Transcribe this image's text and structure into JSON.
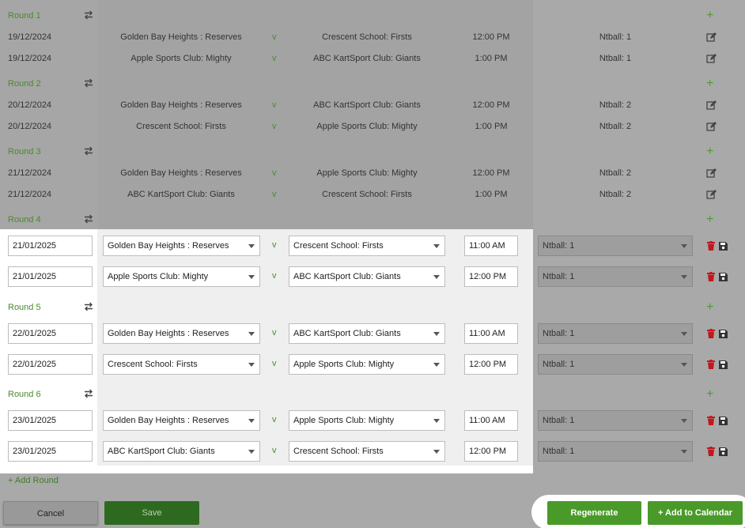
{
  "rounds_readonly": [
    {
      "label": "Round 1",
      "fixtures": [
        {
          "date": "19/12/2024",
          "home": "Golden Bay Heights : Reserves",
          "vs": "v",
          "away": "Crescent School: Firsts",
          "time": "12:00 PM",
          "venue": "Ntball: 1"
        },
        {
          "date": "19/12/2024",
          "home": "Apple Sports Club: Mighty",
          "vs": "v",
          "away": "ABC KartSport Club: Giants",
          "time": "1:00 PM",
          "venue": "Ntball: 1"
        }
      ]
    },
    {
      "label": "Round 2",
      "fixtures": [
        {
          "date": "20/12/2024",
          "home": "Golden Bay Heights : Reserves",
          "vs": "v",
          "away": "ABC KartSport Club: Giants",
          "time": "12:00 PM",
          "venue": "Ntball: 2"
        },
        {
          "date": "20/12/2024",
          "home": "Crescent School: Firsts",
          "vs": "v",
          "away": "Apple Sports Club: Mighty",
          "time": "1:00 PM",
          "venue": "Ntball: 2"
        }
      ]
    },
    {
      "label": "Round 3",
      "fixtures": [
        {
          "date": "21/12/2024",
          "home": "Golden Bay Heights : Reserves",
          "vs": "v",
          "away": "Apple Sports Club: Mighty",
          "time": "12:00 PM",
          "venue": "Ntball: 2"
        },
        {
          "date": "21/12/2024",
          "home": "ABC KartSport Club: Giants",
          "vs": "v",
          "away": "Crescent School: Firsts",
          "time": "1:00 PM",
          "venue": "Ntball: 2"
        }
      ]
    }
  ],
  "rounds_editable": [
    {
      "label": "Round 4",
      "fixtures": [
        {
          "date": "21/01/2025",
          "home": "Golden Bay Heights : Reserves",
          "vs": "v",
          "away": "Crescent School: Firsts",
          "time": "11:00 AM",
          "venue": "Ntball: 1"
        },
        {
          "date": "21/01/2025",
          "home": "Apple Sports Club: Mighty",
          "vs": "v",
          "away": "ABC KartSport Club: Giants",
          "time": "12:00 PM",
          "venue": "Ntball: 1"
        }
      ]
    },
    {
      "label": "Round 5",
      "fixtures": [
        {
          "date": "22/01/2025",
          "home": "Golden Bay Heights : Reserves",
          "vs": "v",
          "away": "ABC KartSport Club: Giants",
          "time": "11:00 AM",
          "venue": "Ntball: 1"
        },
        {
          "date": "22/01/2025",
          "home": "Crescent School: Firsts",
          "vs": "v",
          "away": "Apple Sports Club: Mighty",
          "time": "12:00 PM",
          "venue": "Ntball: 1"
        }
      ]
    },
    {
      "label": "Round 6",
      "fixtures": [
        {
          "date": "23/01/2025",
          "home": "Golden Bay Heights : Reserves",
          "vs": "v",
          "away": "Apple Sports Club: Mighty",
          "time": "11:00 AM",
          "venue": "Ntball: 1"
        },
        {
          "date": "23/01/2025",
          "home": "ABC KartSport Club: Giants",
          "vs": "v",
          "away": "Crescent School: Firsts",
          "time": "12:00 PM",
          "venue": "Ntball: 1"
        }
      ]
    }
  ],
  "add_round": "+ Add Round",
  "buttons": {
    "cancel": "Cancel",
    "save": "Save",
    "regenerate": "Regenerate",
    "add_to_calendar": "+ Add to Calendar"
  },
  "icons": {
    "swap": "swap-arrows-icon",
    "add": "plus-icon",
    "edit": "edit-icon",
    "delete": "trash-icon",
    "save": "floppy-disk-icon"
  },
  "colors": {
    "accent_green": "#4a9a2a",
    "dark_green": "#2d6a1f",
    "delete_red": "#c0181e"
  }
}
